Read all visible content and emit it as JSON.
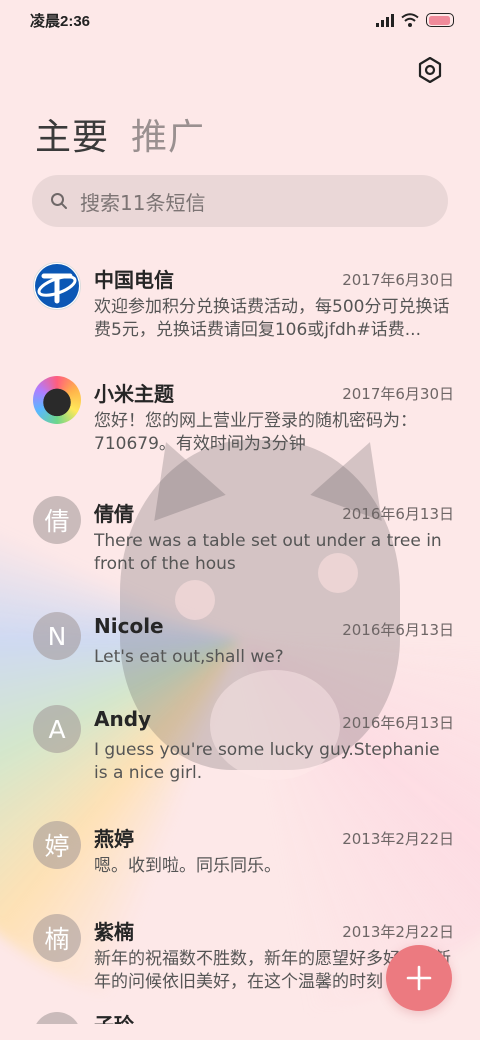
{
  "status_bar": {
    "time": "凌晨2:36",
    "battery_level": 0.95,
    "battery_color": "#f08a9a"
  },
  "header": {
    "tabs": [
      "主要",
      "推广"
    ],
    "active_tab": 0,
    "settings_icon": "gear-icon"
  },
  "search": {
    "placeholder": "搜索11条短信"
  },
  "conversations": [
    {
      "name": "中国电信",
      "date": "2017年6月30日",
      "preview": "欢迎参加积分兑换话费活动，每500分可兑换话费5元，兑换话费请回复106或jfdh#话费...",
      "avatar": {
        "type": "logo",
        "icon": "china-telecom-logo"
      }
    },
    {
      "name": "小米主题",
      "date": "2017年6月30日",
      "preview": "您好！您的网上营业厅登录的随机密码为：710679。有效时间为3分钟",
      "avatar": {
        "type": "image",
        "icon": "cat-sticker-avatar"
      }
    },
    {
      "name": "倩倩",
      "date": "2016年6月13日",
      "preview": "There was a table set out under a tree in front of the hous",
      "avatar": {
        "type": "letter",
        "text": "倩"
      }
    },
    {
      "name": "Nicole",
      "date": "2016年6月13日",
      "preview": "Let's eat out,shall we?",
      "avatar": {
        "type": "letter",
        "text": "N"
      }
    },
    {
      "name": "Andy",
      "date": "2016年6月13日",
      "preview": "I guess you're some lucky guy.Stephanie is a nice girl.",
      "avatar": {
        "type": "letter",
        "text": "A"
      }
    },
    {
      "name": "燕婷",
      "date": "2013年2月22日",
      "preview": "嗯。收到啦。同乐同乐。",
      "avatar": {
        "type": "letter",
        "text": "婷"
      }
    },
    {
      "name": "紫楠",
      "date": "2013年2月22日",
      "preview": "新年的祝福数不胜数，新年的愿望好多好多，新年的问候依旧美好，在这个温馨的时刻",
      "avatar": {
        "type": "letter",
        "text": "楠"
      }
    },
    {
      "name": "子玲",
      "date": "",
      "preview": "",
      "avatar": {
        "type": "letter",
        "text": ""
      }
    }
  ],
  "fab": {
    "icon": "plus-icon",
    "color": "#ec7a80"
  }
}
